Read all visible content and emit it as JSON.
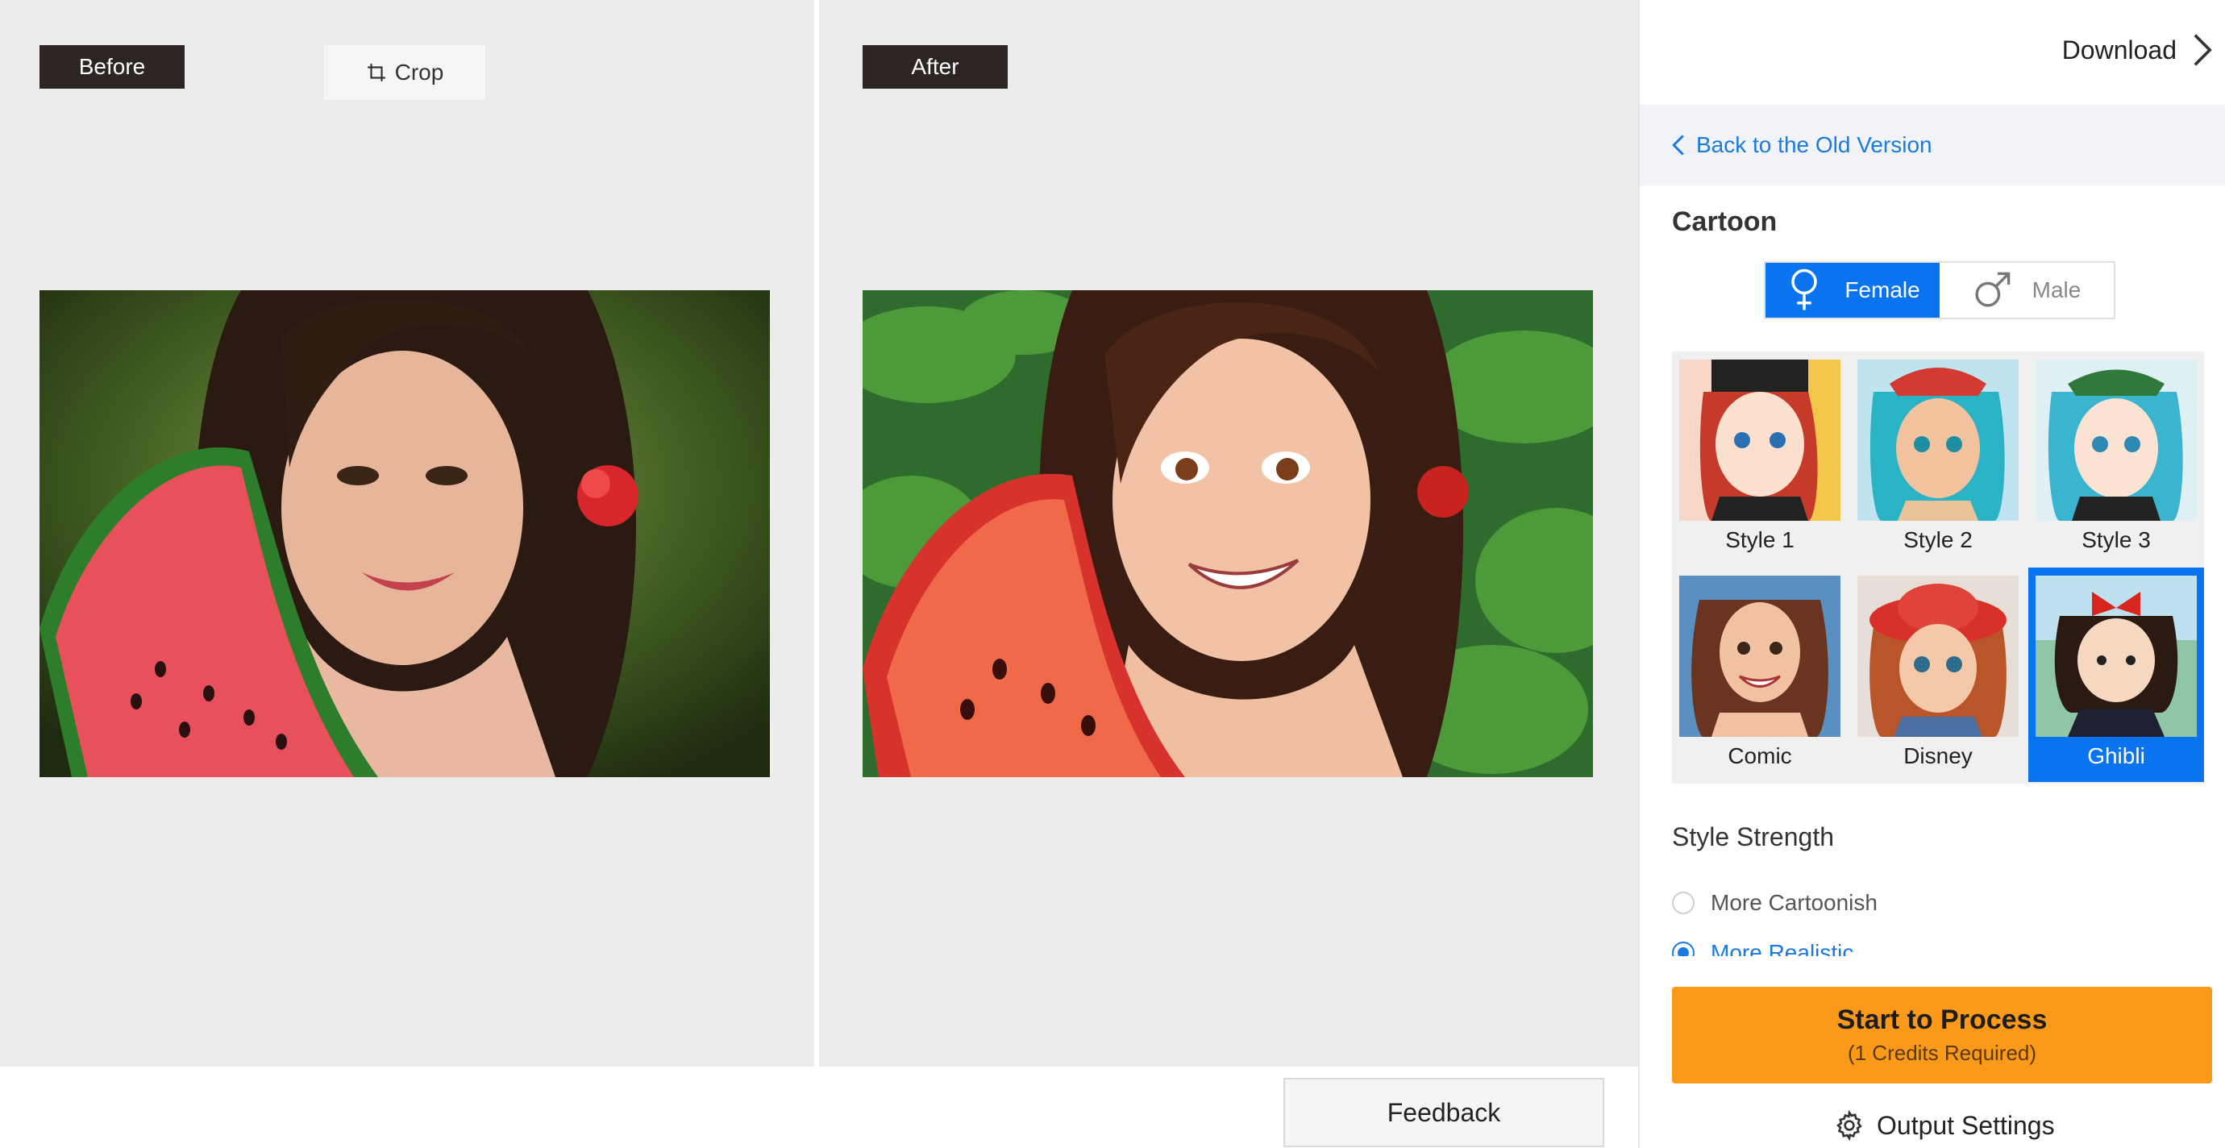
{
  "preview": {
    "before_label": "Before",
    "after_label": "After",
    "crop_label": "Crop",
    "feedback_label": "Feedback"
  },
  "panel": {
    "download_label": "Download",
    "back_label": "Back to the Old Version",
    "section_title": "Cartoon",
    "gender": {
      "female_label": "Female",
      "male_label": "Male",
      "selected": "Female"
    },
    "styles": [
      {
        "label": "Style 1",
        "selected": false
      },
      {
        "label": "Style 2",
        "selected": false
      },
      {
        "label": "Style 3",
        "selected": false
      },
      {
        "label": "Comic",
        "selected": false
      },
      {
        "label": "Disney",
        "selected": false
      },
      {
        "label": "Ghibli",
        "selected": true
      }
    ],
    "strength": {
      "title": "Style Strength",
      "options": [
        {
          "label": "More Cartoonish",
          "checked": false
        },
        {
          "label": "More Realistic",
          "checked": true
        }
      ]
    },
    "process": {
      "label": "Start to Process",
      "sub_label": "(1 Credits Required)"
    },
    "output_settings_label": "Output Settings"
  },
  "colors": {
    "accent_blue": "#0a73f0",
    "link_blue": "#1a7ae0",
    "process_orange": "#fb9a1a",
    "tag_dark": "#2c2524",
    "pane_bg": "#ececec"
  }
}
